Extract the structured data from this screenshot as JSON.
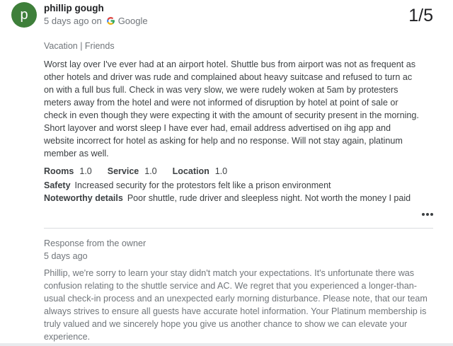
{
  "review": {
    "avatar_letter": "p",
    "author": "phillip gough",
    "time": "5 days ago on",
    "source": "Google",
    "rating": "1/5",
    "trip_type": "Vacation | Friends",
    "text": "Worst lay over I've ever had at an airport hotel. Shuttle bus from airport was not as frequent as other hotels and driver was rude and complained about heavy suitcase and refused to turn ac on with a full bus full. Check in was very slow, we were rudely woken at 5am by protesters meters away from the hotel and were not informed of disruption by hotel at point of sale or check in even though they were expecting it with the amount of security present in the morning. Short layover and worst sleep I have ever had, email address advertised on ihg app and website incorrect for hotel as asking for help and no response. Will not stay again, platinum member as well.",
    "ratings": [
      {
        "label": "Rooms",
        "value": "1.0"
      },
      {
        "label": "Service",
        "value": "1.0"
      },
      {
        "label": "Location",
        "value": "1.0"
      }
    ],
    "safety_label": "Safety",
    "safety_text": "Increased security for the protestors felt like a prison environment",
    "noteworthy_label": "Noteworthy details",
    "noteworthy_text": "Poor shuttle, rude driver and sleepless night. Not worth the money I paid"
  },
  "response": {
    "title": "Response from the owner",
    "date": "5 days ago",
    "text": "Phillip, we're sorry to learn your stay didn't match your expectations. It's unfortunate there was confusion relating to the shuttle service and AC. We regret that you experienced a longer-than-usual check-in process and an unexpected early morning disturbance. Please note, that our team always strives to ensure all guests have accurate hotel information. Your Platinum membership is truly valued and we sincerely hope you give us another chance to show we can elevate your experience."
  },
  "icons": {
    "avatar_color": "#3e7f3a",
    "source_icon": "google-g-icon",
    "more_icon": "more-horiz-icon"
  }
}
